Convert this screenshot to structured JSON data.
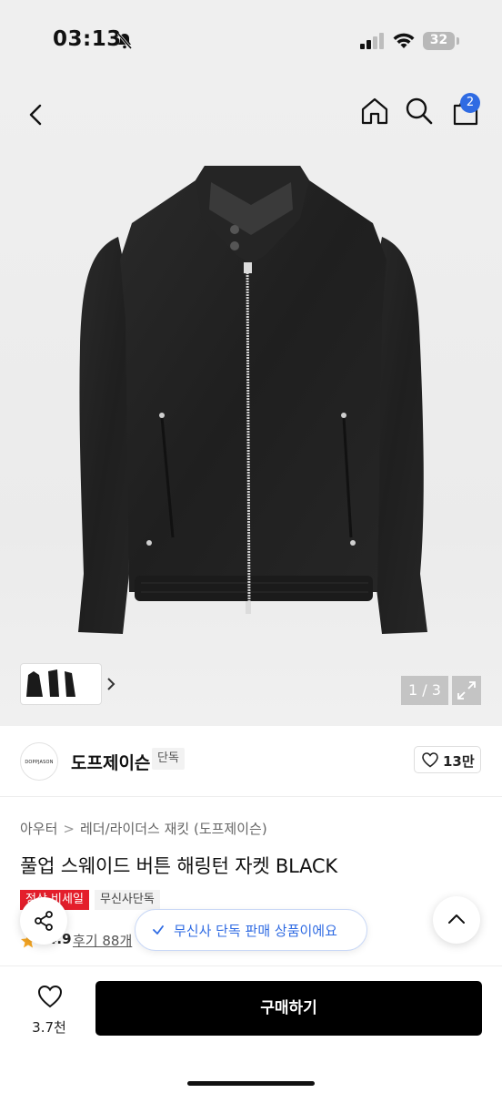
{
  "status_bar": {
    "time": "03:13",
    "battery": "32"
  },
  "header": {
    "cart_count": "2"
  },
  "gallery": {
    "counter": "1 / 3"
  },
  "brand": {
    "logo_text": "DOPPJASON",
    "name": "도프제이슨",
    "tag": "단독",
    "likes": "13만"
  },
  "product": {
    "breadcrumb": [
      "아우터",
      "레더/라이더스 재킷 (도프제이슨)"
    ],
    "title": "풀업 스웨이드 버튼 해링턴 자켓 BLACK",
    "badges": {
      "sale": "정상 비세일",
      "exclusive": "무신사단독"
    },
    "rating": "4.9",
    "reviews": "후기 88개"
  },
  "toast": {
    "text": "무신사 단독 판매 상품이에요"
  },
  "bottom_bar": {
    "wish_count": "3.7천",
    "buy_label": "구매하기"
  },
  "colors": {
    "accent": "#2f6be3",
    "sale_red": "#e41e2b",
    "buy_black": "#000000"
  }
}
